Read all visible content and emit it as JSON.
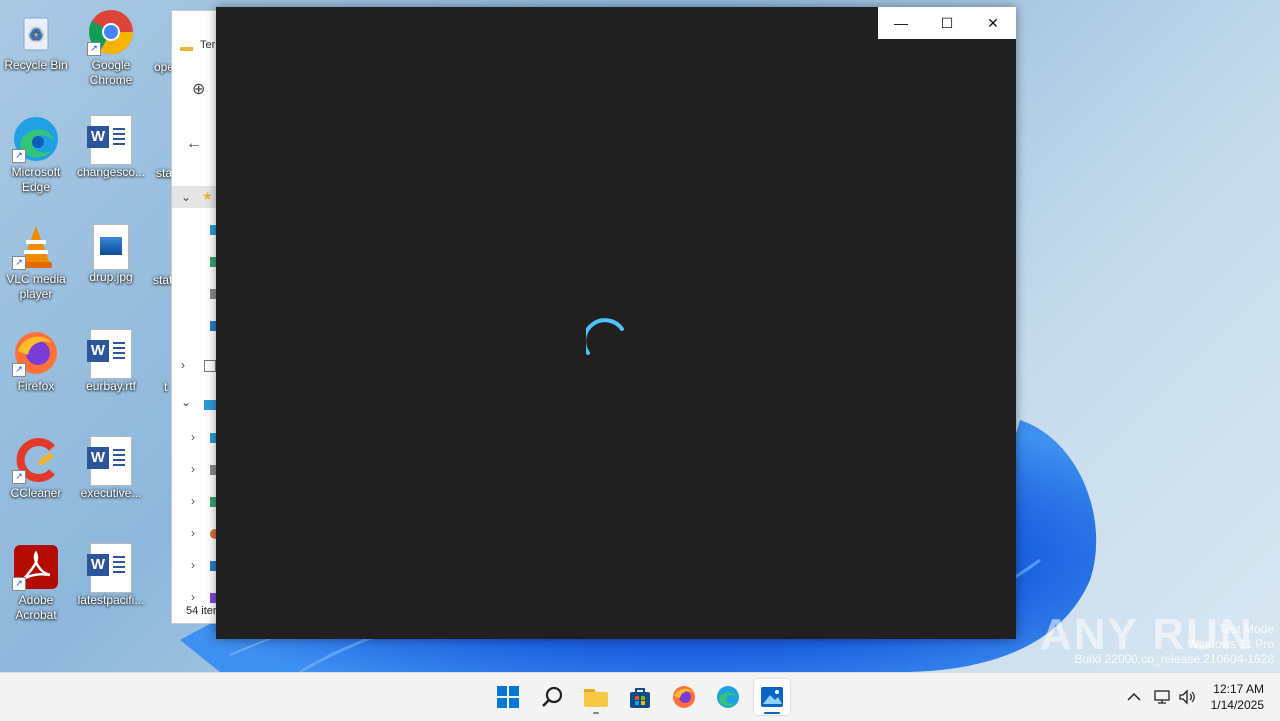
{
  "desktop": {
    "icons": [
      {
        "label": "Recycle Bin"
      },
      {
        "label": "Google Chrome"
      },
      {
        "label": "ope"
      },
      {
        "label": "Microsoft Edge"
      },
      {
        "label": "changesco..."
      },
      {
        "label": "sta"
      },
      {
        "label": "VLC media player"
      },
      {
        "label": "drup.jpg"
      },
      {
        "label": "stat"
      },
      {
        "label": "Firefox"
      },
      {
        "label": "eurbay.rtf"
      },
      {
        "label": "t"
      },
      {
        "label": "CCleaner"
      },
      {
        "label": "executive..."
      },
      {
        "label": "Adobe Acrobat"
      },
      {
        "label": "latestpacifi..."
      }
    ]
  },
  "explorer": {
    "tab_label": "Ter",
    "status": "54 iter"
  },
  "photos_window": {
    "minimize_glyph": "—",
    "maximize_glyph": "☐",
    "close_glyph": "✕",
    "spinner_color": "#4cc2ff"
  },
  "watermark": {
    "brand": "ANY RUN",
    "line1": "Test Mode",
    "line2": "Windows 11 Pro",
    "line3": "Build 22000.co_release.210604-1628"
  },
  "taskbar": {
    "apps": [
      {
        "name": "start-button"
      },
      {
        "name": "search"
      },
      {
        "name": "file-explorer"
      },
      {
        "name": "microsoft-store"
      },
      {
        "name": "firefox"
      },
      {
        "name": "edge"
      },
      {
        "name": "photos"
      }
    ],
    "tray_chevron": "^",
    "time": "12:17 AM",
    "date": "1/14/2025"
  },
  "colors": {
    "accent": "#0067c0",
    "window_dark": "#202020"
  }
}
